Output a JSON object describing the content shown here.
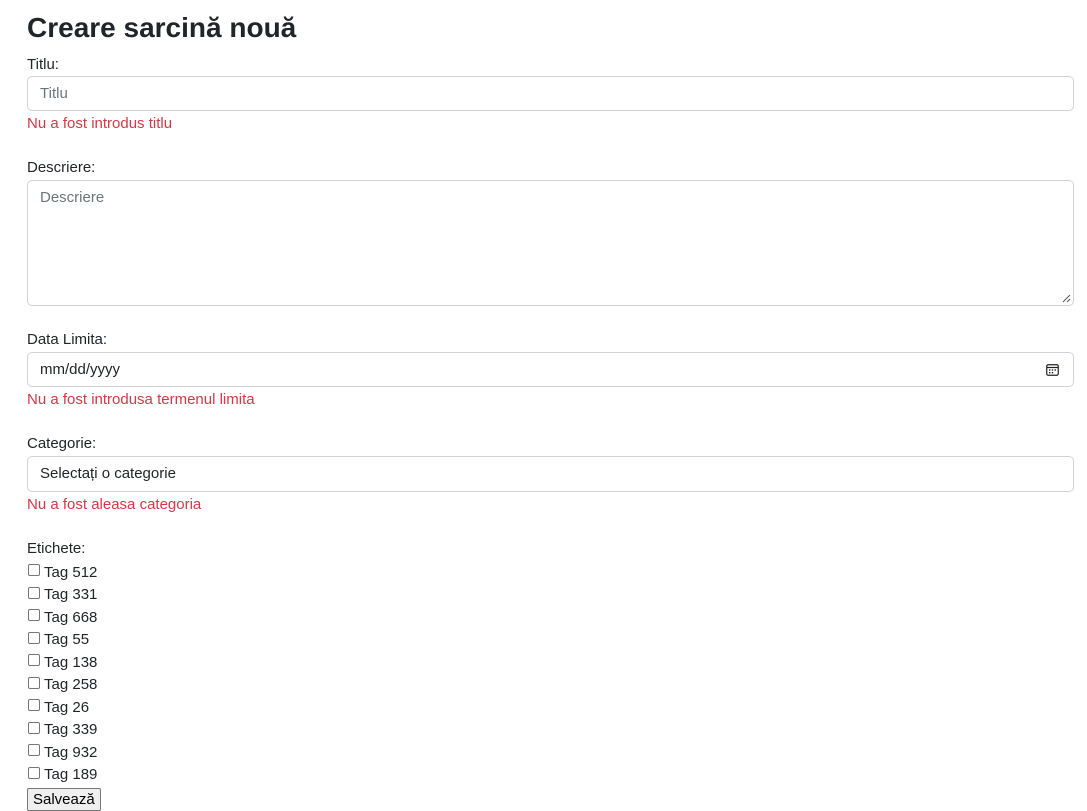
{
  "page": {
    "title": "Creare sarcină nouă"
  },
  "form": {
    "title": {
      "label": "Titlu:",
      "placeholder": "Titlu",
      "error": "Nu a fost introdus titlu"
    },
    "description": {
      "label": "Descriere:",
      "placeholder": "Descriere"
    },
    "deadline": {
      "label": "Data Limita:",
      "value": "mm/dd/yyyy",
      "icon": "calendar-icon",
      "error": "Nu a fost introdusa termenul limita"
    },
    "category": {
      "label": "Categorie:",
      "selected": "Selectați o categorie",
      "error": "Nu a fost aleasa categoria"
    },
    "tags": {
      "label": "Etichete:",
      "items": [
        {
          "label": "Tag 512",
          "checked": false
        },
        {
          "label": "Tag 331",
          "checked": false
        },
        {
          "label": "Tag 668",
          "checked": false
        },
        {
          "label": "Tag 55",
          "checked": false
        },
        {
          "label": "Tag 138",
          "checked": false
        },
        {
          "label": "Tag 258",
          "checked": false
        },
        {
          "label": "Tag 26",
          "checked": false
        },
        {
          "label": "Tag 339",
          "checked": false
        },
        {
          "label": "Tag 932",
          "checked": false
        },
        {
          "label": "Tag 189",
          "checked": false
        }
      ]
    },
    "save_label": "Salvează"
  },
  "colors": {
    "error": "#dc3545",
    "border": "#ced4da",
    "text": "#212529",
    "placeholder": "#6c757d"
  }
}
